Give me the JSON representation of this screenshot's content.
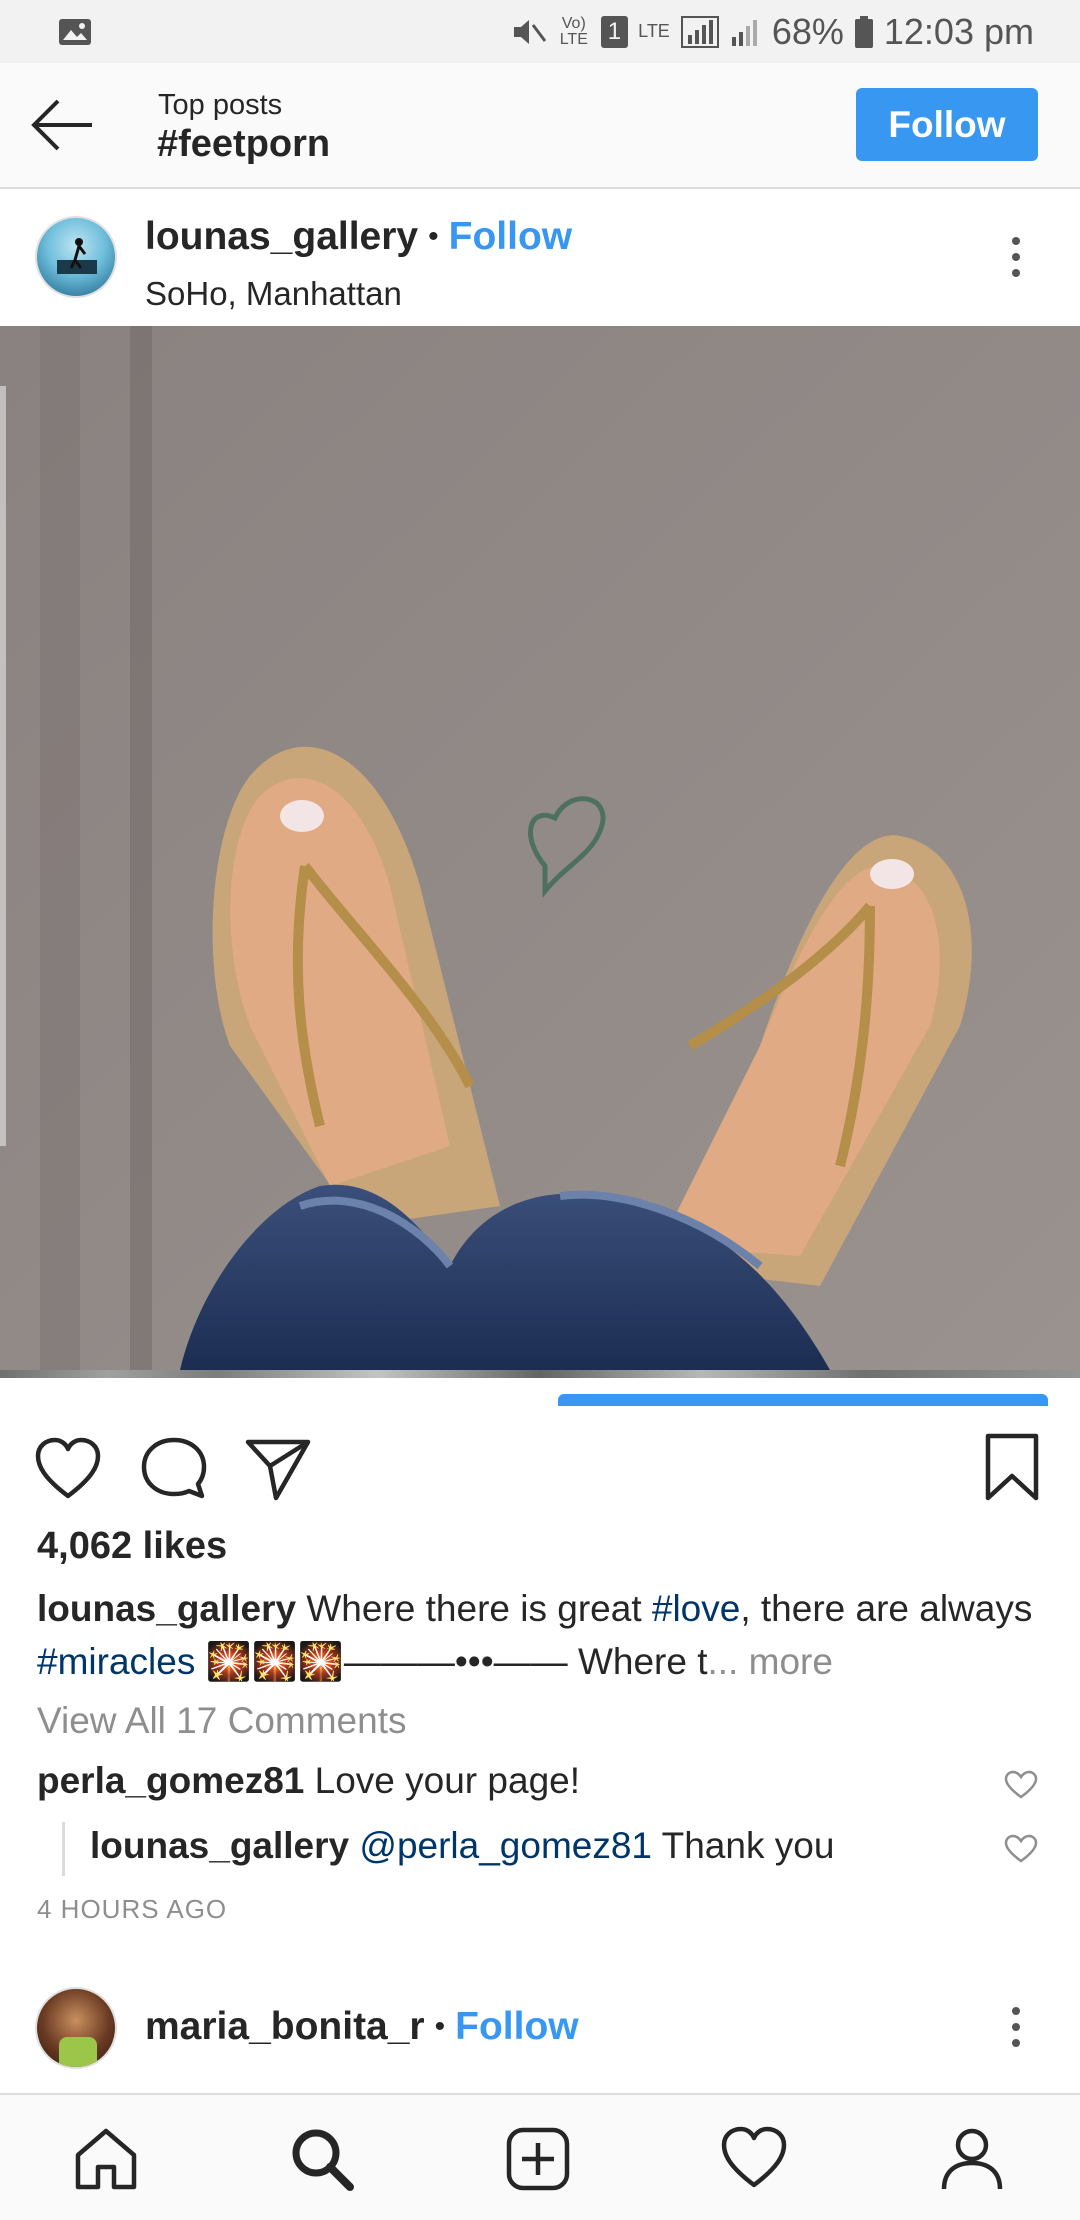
{
  "status_bar": {
    "battery": "68%",
    "time": "12:03 pm",
    "sim_slot": "1",
    "volte": "Vo) LTE",
    "lte": "LTE"
  },
  "header": {
    "subtitle": "Top posts",
    "title": "#feetporn",
    "follow_label": "Follow"
  },
  "post": {
    "username": "lounas_gallery",
    "separator": "•",
    "follow_label": "Follow",
    "location": "SoHo, Manhattan",
    "likes": "4,062 likes",
    "caption": {
      "username": "lounas_gallery",
      "text1": " Where there is great ",
      "tag1": "#love",
      "text2": ", there are always ",
      "tag2": "#miracles",
      "text3": " 🎇🎇🎇———•••—— Where t",
      "more": "... more"
    },
    "view_all_comments": "View All 17 Comments",
    "comments": [
      {
        "username": "perla_gomez81",
        "text": " Love your page!"
      },
      {
        "username": "lounas_gallery",
        "mention": "@perla_gomez81",
        "text": " Thank you"
      }
    ],
    "time_ago": "4 HOURS AGO"
  },
  "next_post": {
    "username": "maria_bonita_r",
    "separator": "•",
    "follow_label": "Follow"
  },
  "colors": {
    "accent": "#3897f0",
    "hashtag": "#003569",
    "muted": "#8e8e8e"
  },
  "icons": {
    "like": "heart-icon",
    "comment": "comment-icon",
    "share": "send-icon",
    "save": "bookmark-icon",
    "nav": [
      "home-icon",
      "search-icon",
      "add-post-icon",
      "activity-heart-icon",
      "profile-icon"
    ]
  }
}
